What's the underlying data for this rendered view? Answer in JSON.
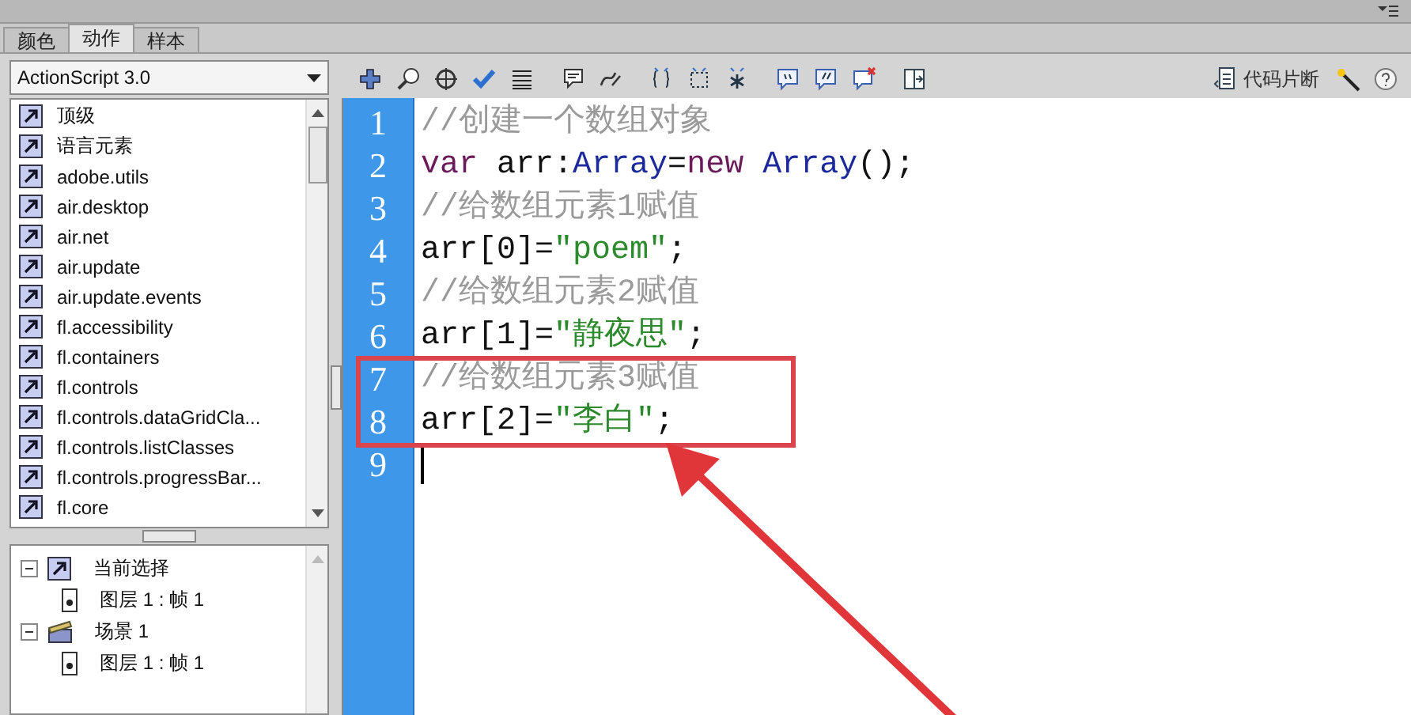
{
  "tabs": [
    {
      "label": "颜色",
      "selected": false
    },
    {
      "label": "动作",
      "selected": true
    },
    {
      "label": "样本",
      "selected": false
    }
  ],
  "version_select": {
    "value": "ActionScript 3.0"
  },
  "library_list": [
    "顶级",
    "语言元素",
    "adobe.utils",
    "air.desktop",
    "air.net",
    "air.update",
    "air.update.events",
    "fl.accessibility",
    "fl.containers",
    "fl.controls",
    "fl.controls.dataGridCla...",
    "fl.controls.listClasses",
    "fl.controls.progressBar...",
    "fl.core"
  ],
  "script_tree": [
    {
      "label": "当前选择",
      "kind": "selection",
      "expanded": true,
      "children": [
        {
          "label": "图层 1 : 帧 1"
        }
      ]
    },
    {
      "label": "场景 1",
      "kind": "scene",
      "expanded": true,
      "children": [
        {
          "label": "图层 1 : 帧 1"
        }
      ]
    }
  ],
  "toolbar": {
    "snippets_label": "代码片断"
  },
  "code_lines": [
    {
      "number": "1",
      "tokens": [
        {
          "kind": "comment",
          "text": "//创建一个数组对象"
        }
      ]
    },
    {
      "number": "2",
      "tokens": [
        {
          "kind": "keyword",
          "text": "var"
        },
        {
          "kind": "plain",
          "text": " arr:"
        },
        {
          "kind": "type",
          "text": "Array"
        },
        {
          "kind": "plain",
          "text": "="
        },
        {
          "kind": "keyword",
          "text": "new"
        },
        {
          "kind": "type",
          "text": " Array"
        },
        {
          "kind": "plain",
          "text": "();"
        }
      ]
    },
    {
      "number": "3",
      "tokens": [
        {
          "kind": "comment",
          "text": "//给数组元素1赋值"
        }
      ]
    },
    {
      "number": "4",
      "tokens": [
        {
          "kind": "plain",
          "text": "arr[0]="
        },
        {
          "kind": "string",
          "text": "\"poem\""
        },
        {
          "kind": "plain",
          "text": ";"
        }
      ]
    },
    {
      "number": "5",
      "tokens": [
        {
          "kind": "comment",
          "text": "//给数组元素2赋值"
        }
      ]
    },
    {
      "number": "6",
      "tokens": [
        {
          "kind": "plain",
          "text": "arr[1]="
        },
        {
          "kind": "string",
          "text": "\"静夜思\""
        },
        {
          "kind": "plain",
          "text": ";"
        }
      ]
    },
    {
      "number": "7",
      "highlighted": true,
      "tokens": [
        {
          "kind": "comment",
          "text": "//给数组元素3赋值"
        }
      ]
    },
    {
      "number": "8",
      "highlighted": true,
      "tokens": [
        {
          "kind": "plain",
          "text": "arr[2]="
        },
        {
          "kind": "string",
          "text": "\"李白\""
        },
        {
          "kind": "plain",
          "text": ";"
        }
      ]
    },
    {
      "number": "9",
      "cursor": true
    }
  ]
}
